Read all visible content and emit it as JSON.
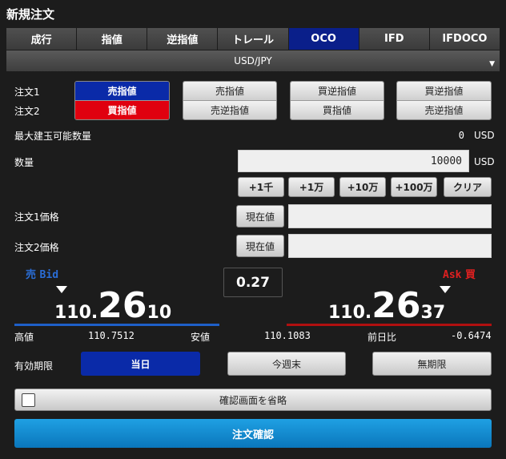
{
  "header": {
    "title": "新規注文"
  },
  "tabs": [
    {
      "label": "成行"
    },
    {
      "label": "指値"
    },
    {
      "label": "逆指値"
    },
    {
      "label": "トレール"
    },
    {
      "label": "OCO"
    },
    {
      "label": "IFD"
    },
    {
      "label": "IFDOCO"
    }
  ],
  "active_tab": "OCO",
  "pair": {
    "label": "USD/JPY",
    "caret": "▼"
  },
  "order_labels": {
    "order1": "注文1",
    "order2": "注文2"
  },
  "order_combos": [
    {
      "top": "売指値",
      "bottom": "買指値",
      "selected": true
    },
    {
      "top": "売指値",
      "bottom": "売逆指値",
      "selected": false
    },
    {
      "top": "買逆指値",
      "bottom": "買指値",
      "selected": false
    },
    {
      "top": "買逆指値",
      "bottom": "売逆指値",
      "selected": false
    }
  ],
  "max_qty": {
    "label": "最大建玉可能数量",
    "value": "0",
    "unit": "USD"
  },
  "qty": {
    "label": "数量",
    "value": "10000",
    "unit": "USD"
  },
  "qty_buttons": [
    {
      "label": "+1千"
    },
    {
      "label": "+1万"
    },
    {
      "label": "+10万"
    },
    {
      "label": "+100万"
    },
    {
      "label": "クリア"
    }
  ],
  "price1": {
    "label": "注文1価格",
    "button": "現在値",
    "value": ""
  },
  "price2": {
    "label": "注文2価格",
    "button": "現在値",
    "value": ""
  },
  "bid": {
    "label_jp": "売",
    "label_en": "Bid",
    "prefix": "110.",
    "big": "26",
    "small": "10"
  },
  "ask": {
    "label_en": "Ask",
    "label_jp": "買",
    "prefix": "110.",
    "big": "26",
    "small": "37"
  },
  "spread": "0.27",
  "stats": {
    "high_label": "高値",
    "high_value": "110.7512",
    "low_label": "安値",
    "low_value": "110.1083",
    "change_label": "前日比",
    "change_value": "-0.6474"
  },
  "expiry": {
    "label": "有効期限",
    "options": [
      {
        "label": "当日",
        "active": true
      },
      {
        "label": "今週末",
        "active": false
      },
      {
        "label": "無期限",
        "active": false
      }
    ]
  },
  "skip_confirm": {
    "label": "確認画面を省略",
    "checked": false
  },
  "confirm_button": {
    "label": "注文確認"
  },
  "colors": {
    "accent_blue": "#0a2aa8",
    "sell_red": "#e0000f",
    "confirm": "#1490d4"
  }
}
